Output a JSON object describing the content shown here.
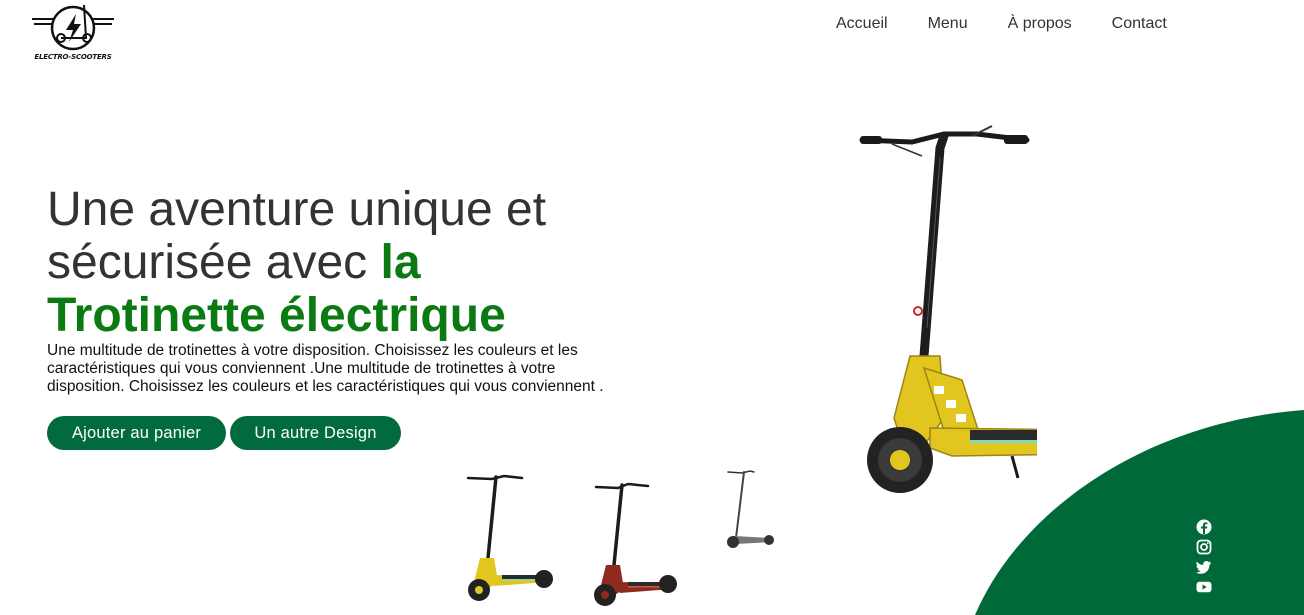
{
  "brand": {
    "logo_text": "ELECTRO-SCOOTERS",
    "logo_icon": "scooter-lightning-icon"
  },
  "nav": {
    "items": [
      {
        "label": "Accueil"
      },
      {
        "label": "Menu"
      },
      {
        "label": "À propos"
      },
      {
        "label": "Contact"
      }
    ]
  },
  "hero": {
    "title_part1": "Une aventure unique et sécurisée avec",
    "title_accent": "la Trotinette électrique",
    "description": "Une multitude de trotinettes à votre disposition. Choisissez les couleurs et les caractéristiques qui vous conviennent .Une multitude de trotinettes à votre disposition. Choisissez les couleurs et les caractéristiques qui vous conviennent .",
    "primary_button": "Ajouter au panier",
    "secondary_button": "Un autre Design"
  },
  "thumbnails": [
    {
      "name": "yellow-scooter"
    },
    {
      "name": "red-scooter"
    },
    {
      "name": "grey-scooter"
    }
  ],
  "socials": [
    "facebook-icon",
    "instagram-icon",
    "twitter-icon",
    "youtube-icon"
  ],
  "colors": {
    "accent_green": "#0b7a13",
    "button_green": "#016b3d",
    "shape_green": "#00693a",
    "frame_yellow": "#e3c51f"
  }
}
